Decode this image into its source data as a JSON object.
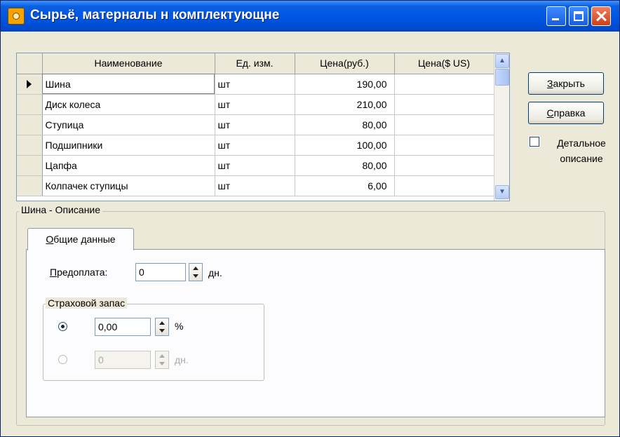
{
  "window": {
    "title": "Сырьё, матерналы н комплектующне"
  },
  "grid": {
    "columns": [
      "Наименование",
      "Ед. изм.",
      "Цена(руб.)",
      "Цена($ US)"
    ],
    "rows": [
      {
        "name": "Шина",
        "unit": "шт",
        "price_rub": "190,00",
        "price_usd": ""
      },
      {
        "name": "Диск колеса",
        "unit": "шт",
        "price_rub": "210,00",
        "price_usd": ""
      },
      {
        "name": "Ступица",
        "unit": "шт",
        "price_rub": "80,00",
        "price_usd": ""
      },
      {
        "name": "Подшипники",
        "unit": "шт",
        "price_rub": "100,00",
        "price_usd": ""
      },
      {
        "name": "Цапфа",
        "unit": "шт",
        "price_rub": "80,00",
        "price_usd": ""
      },
      {
        "name": "Колпачек ступицы",
        "unit": "шт",
        "price_rub": "6,00",
        "price_usd": ""
      }
    ]
  },
  "side": {
    "close_first": "З",
    "close_rest": "акрыть",
    "help_first": "С",
    "help_rest": "правка",
    "detail_first": "Д",
    "detail_rest": "етальное",
    "detail_line2": "описание",
    "detail_checked": false
  },
  "description": {
    "title": "Шина - Описание",
    "tab_first": "О",
    "tab_rest": "бщие данные",
    "prepay_first": "П",
    "prepay_rest": "редоплата:",
    "prepay_value": "0",
    "prepay_unit": "дн.",
    "reserve_title": "Страховой запас",
    "reserve_percent_value": "0,00",
    "reserve_percent_unit": "%",
    "reserve_days_value": "0",
    "reserve_days_unit": "дн.",
    "selected_mode": "percent"
  },
  "colors": {
    "titlebar": "#0054E3",
    "dialog_bg": "#ECE9D8",
    "tab_bg": "#FCFCFE"
  }
}
